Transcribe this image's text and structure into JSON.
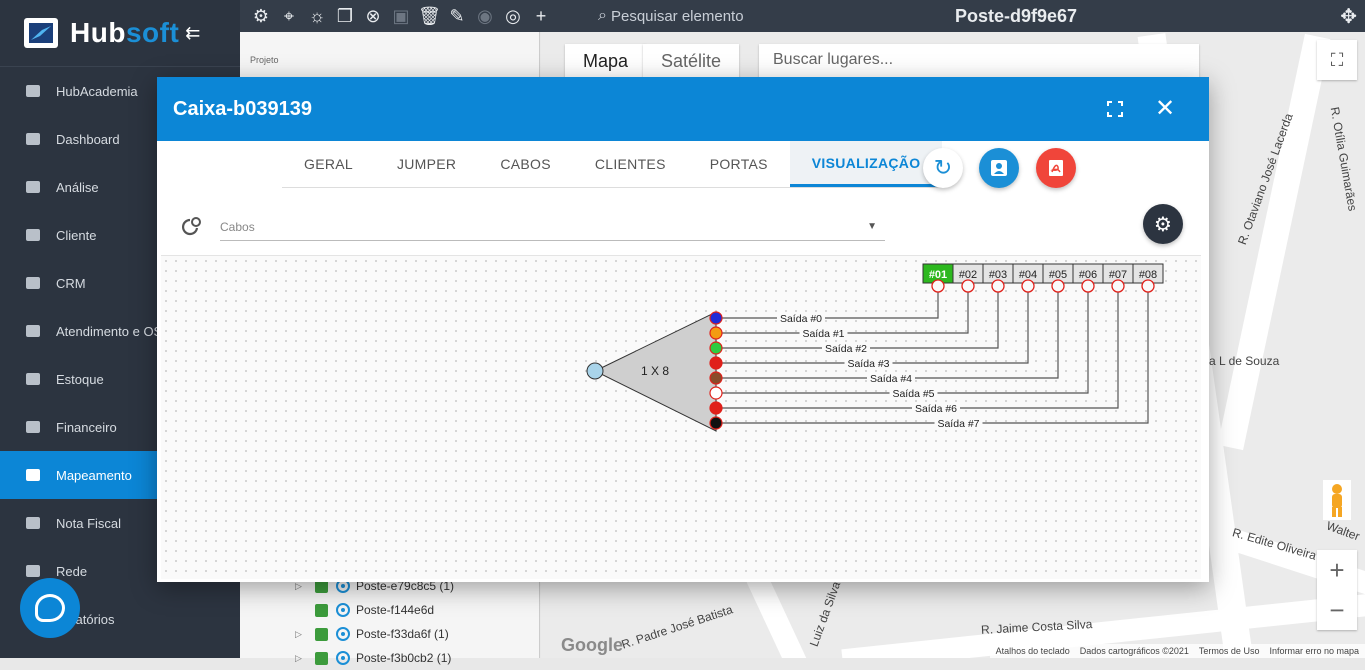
{
  "app": {
    "logo_prefix": "Hub",
    "logo_suffix": "soft",
    "collapse_icon": "arrow-collapse-icon"
  },
  "sidebar": {
    "items": [
      {
        "label": "HubAcademia",
        "icon": "book-icon"
      },
      {
        "label": "Dashboard",
        "icon": "dashboard-icon"
      },
      {
        "label": "Análise",
        "icon": "pie-chart-icon"
      },
      {
        "label": "Cliente",
        "icon": "contact-card-icon"
      },
      {
        "label": "CRM",
        "icon": "kanban-icon"
      },
      {
        "label": "Atendimento e OS",
        "icon": "calendar-clock-icon"
      },
      {
        "label": "Estoque",
        "icon": "box-icon"
      },
      {
        "label": "Financeiro",
        "icon": "money-icon"
      },
      {
        "label": "Mapeamento",
        "icon": "map-pin-icon",
        "active": true
      },
      {
        "label": "Nota Fiscal",
        "icon": "receipt-icon"
      },
      {
        "label": "Rede",
        "icon": "network-icon"
      },
      {
        "label": "Relatórios",
        "icon": "report-icon"
      }
    ]
  },
  "topbar": {
    "search_placeholder": "Pesquisar elemento",
    "element_title": "Poste-d9f9e67"
  },
  "project_panel": {
    "label": "Projeto",
    "tree": [
      {
        "label": "Poste-e79c8c5 (1)"
      },
      {
        "label": "Poste-f144e6d"
      },
      {
        "label": "Poste-f33da6f (1)"
      },
      {
        "label": "Poste-f3b0cb2 (1)"
      }
    ]
  },
  "map": {
    "tab_map": "Mapa",
    "tab_satellite": "Satélite",
    "search_placeholder": "Buscar lugares...",
    "streets": [
      "R. Otília Guimarães",
      "R. Otaviano José Lacerda",
      "a L de Souza",
      "R. Edite Oliveira",
      "R. Jaime Costa Silva",
      "R. Padre José Batista",
      "Luiz da Silva",
      "Walter"
    ],
    "footer": [
      "Atalhos do teclado",
      "Dados cartográficos ©2021",
      "Termos de Uso",
      "Informar erro no mapa"
    ],
    "google": "Google"
  },
  "modal": {
    "title": "Caixa-b039139",
    "tabs": [
      "GERAL",
      "JUMPER",
      "CABOS",
      "CLIENTES",
      "PORTAS",
      "VISUALIZAÇÃO"
    ],
    "active_tab": "VISUALIZAÇÃO",
    "filter_placeholder": "Cabos",
    "splitter": {
      "label": "1 X 8",
      "outputs": [
        "Saída #0",
        "Saída #1",
        "Saída #2",
        "Saída #3",
        "Saída #4",
        "Saída #5",
        "Saída #6",
        "Saída #7"
      ],
      "output_colors": [
        "#1f2bd6",
        "#f39c12",
        "#2ecc40",
        "#e0201a",
        "#8a4b2a",
        "#ffffff",
        "#e0201a",
        "#111111"
      ],
      "ports": [
        "#01",
        "#02",
        "#03",
        "#04",
        "#05",
        "#06",
        "#07",
        "#08"
      ],
      "active_port": "#01"
    }
  },
  "colors": {
    "accent": "#0c86d6",
    "sidebar_bg": "#2c3440",
    "pdf_red": "#f0453a",
    "port_active": "#2db81f"
  }
}
